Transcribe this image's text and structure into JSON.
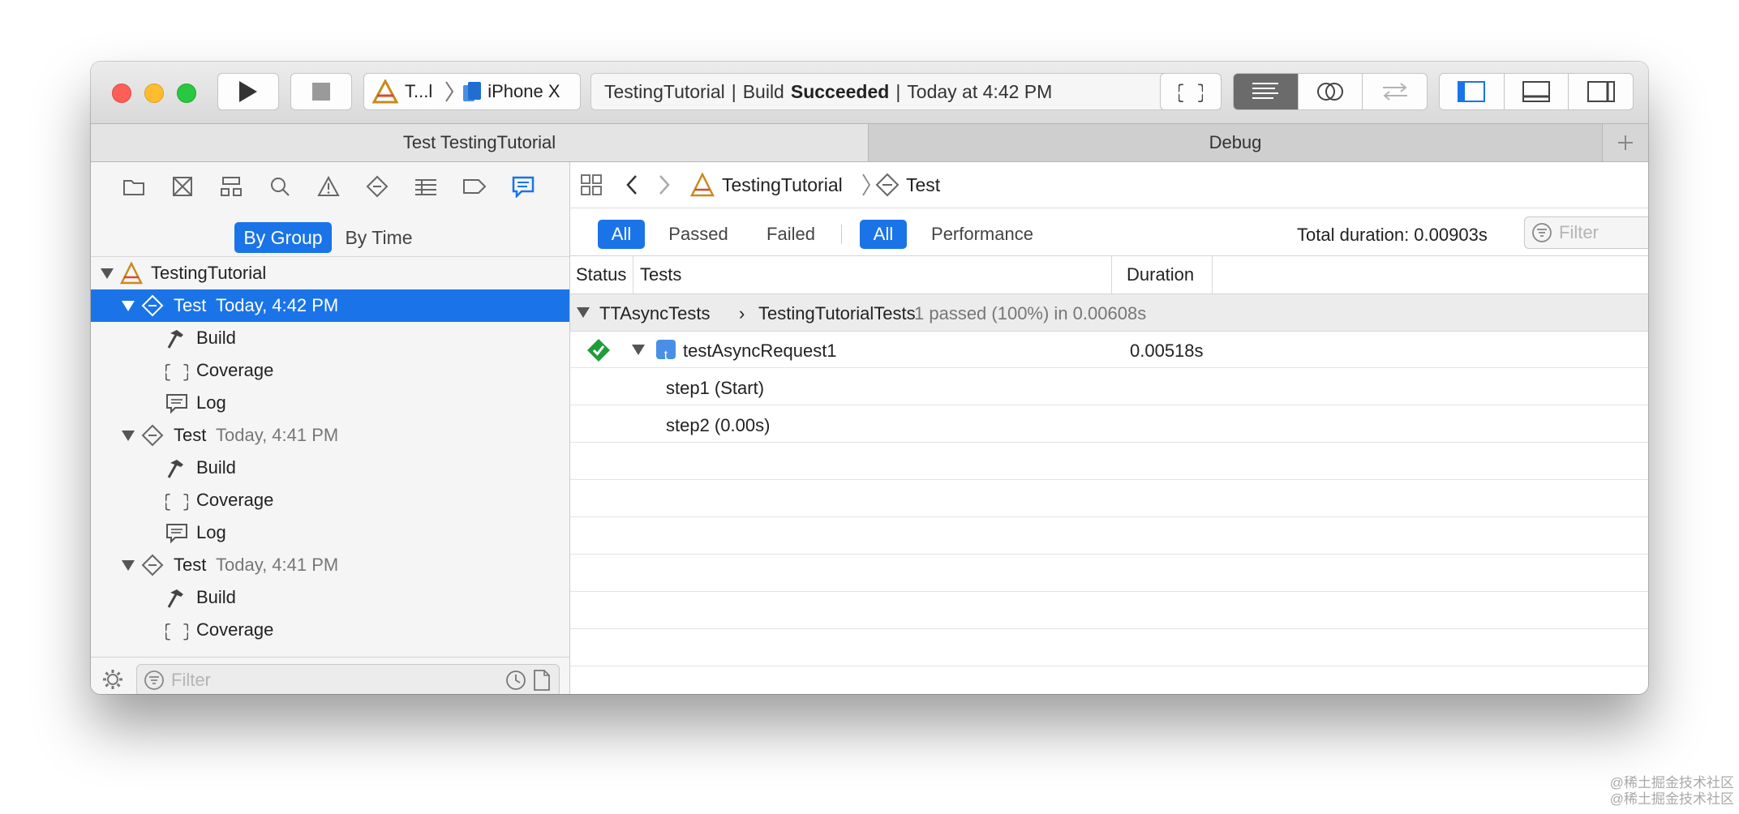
{
  "toolbar": {
    "scheme_name": "T...l",
    "destination": "iPhone X",
    "activity": {
      "project": "TestingTutorial",
      "status_prefix": "Build",
      "status": "Succeeded",
      "time": "Today at 4:42 PM"
    }
  },
  "tabs": [
    "Test TestingTutorial",
    "Debug"
  ],
  "navigator": {
    "segments": [
      "By Group",
      "By Time"
    ],
    "project": "TestingTutorial",
    "runs": [
      {
        "label": "Test",
        "time": "Today, 4:42 PM",
        "selected": true,
        "children": [
          "Build",
          "Coverage",
          "Log"
        ]
      },
      {
        "label": "Test",
        "time": "Today, 4:41 PM",
        "selected": false,
        "children": [
          "Build",
          "Coverage",
          "Log"
        ]
      },
      {
        "label": "Test",
        "time": "Today, 4:41 PM",
        "selected": false,
        "children": [
          "Build",
          "Coverage"
        ]
      }
    ],
    "filter_placeholder": "Filter"
  },
  "editor": {
    "breadcrumb": [
      "TestingTutorial",
      "Test"
    ],
    "filters": {
      "all_1": "All",
      "passed": "Passed",
      "failed": "Failed",
      "all_2": "All",
      "performance": "Performance"
    },
    "total_duration": "Total duration: 0.00903s",
    "filter_placeholder": "Filter",
    "columns": {
      "status": "Status",
      "tests": "Tests",
      "duration": "Duration"
    },
    "group": {
      "class": "TTAsyncTests",
      "separator": "›",
      "target": "TestingTutorialTests",
      "summary": "1 passed (100%) in 0.00608s"
    },
    "test": {
      "badge": "t",
      "name": "testAsyncRequest1",
      "duration": "0.00518s"
    },
    "steps": [
      "step1 (Start)",
      "step2 (0.00s)"
    ]
  },
  "watermark": [
    "@稀土掘金技术社区",
    "@稀土掘金技术社区"
  ],
  "colors": {
    "accent": "#1a74e8",
    "pass": "#1f9d3a",
    "close": "#fd5f57",
    "minimize": "#febc2e",
    "zoom": "#28c840"
  }
}
